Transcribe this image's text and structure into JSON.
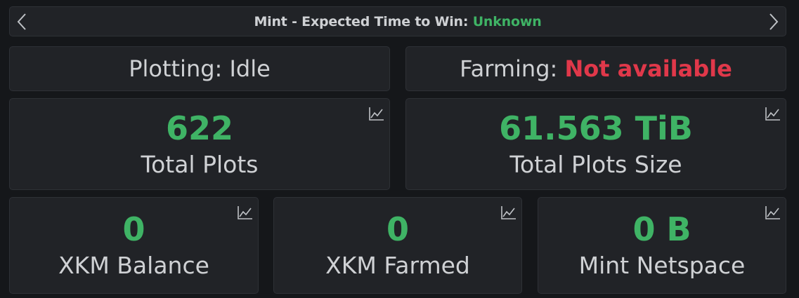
{
  "header": {
    "prefix": "Mint - Expected Time to Win: ",
    "value": "Unknown"
  },
  "plotting": {
    "label": "Plotting: Idle"
  },
  "farming": {
    "label": "Farming: ",
    "value": "Not available"
  },
  "stats": {
    "total_plots": {
      "value": "622",
      "label": "Total Plots"
    },
    "total_plots_size": {
      "value": "61.563 TiB",
      "label": "Total Plots Size"
    },
    "xkm_balance": {
      "value": "0",
      "label": "XKM Balance"
    },
    "xkm_farmed": {
      "value": "0",
      "label": "XKM Farmed"
    },
    "mint_netspace": {
      "value": "0 B",
      "label": "Mint Netspace"
    }
  },
  "colors": {
    "positive": "#3fb365",
    "negative": "#e0384a",
    "panel": "#212327",
    "background": "#15171a"
  },
  "icons": {
    "prev": "chevron-left-icon",
    "next": "chevron-right-icon",
    "chart": "chart-line-icon"
  }
}
